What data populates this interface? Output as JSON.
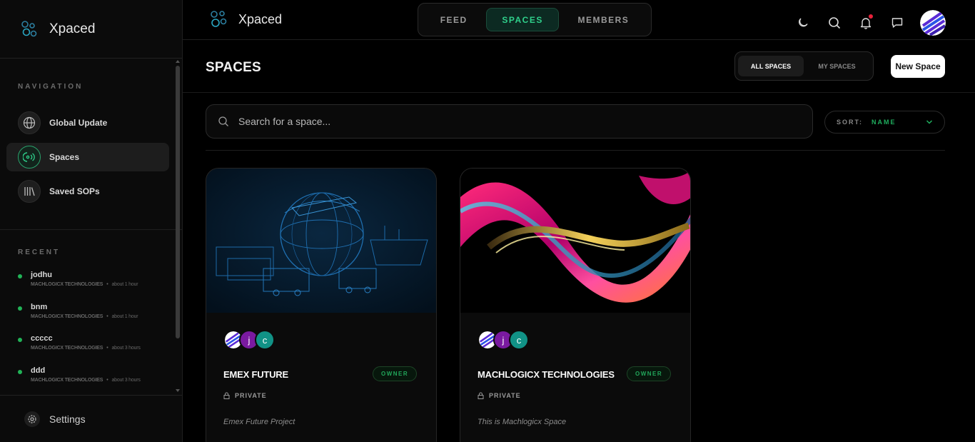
{
  "app": {
    "name": "Xpaced"
  },
  "sidebar": {
    "navigation_label": "NAVIGATION",
    "items": [
      {
        "label": "Global Update",
        "icon": "globe-icon",
        "active": false
      },
      {
        "label": "Spaces",
        "icon": "spaces-icon",
        "active": true
      },
      {
        "label": "Saved SOPs",
        "icon": "library-icon",
        "active": false
      }
    ],
    "recent_label": "RECENT",
    "recent": [
      {
        "name": "jodhu",
        "org": "MACHLOGICX TECHNOLOGIES",
        "time": "about 1 hour"
      },
      {
        "name": "bnm",
        "org": "MACHLOGICX TECHNOLOGIES",
        "time": "about 1 hour"
      },
      {
        "name": "ccccc",
        "org": "MACHLOGICX TECHNOLOGIES",
        "time": "about 3 hours"
      },
      {
        "name": "ddd",
        "org": "MACHLOGICX TECHNOLOGIES",
        "time": "about 3 hours"
      }
    ],
    "settings_label": "Settings"
  },
  "topbar": {
    "tabs": [
      {
        "label": "FEED",
        "active": false
      },
      {
        "label": "SPACES",
        "active": true
      },
      {
        "label": "MEMBERS",
        "active": false
      }
    ],
    "icons": [
      "moon-icon",
      "search-icon",
      "bell-icon",
      "chat-icon"
    ]
  },
  "page": {
    "title": "SPACES",
    "filter": {
      "all": "ALL SPACES",
      "mine": "MY SPACES",
      "selected": "all"
    },
    "new_space_label": "New Space",
    "search_placeholder": "Search for a space...",
    "sort_label": "SORT:",
    "sort_value": "NAME"
  },
  "spaces": [
    {
      "title": "EMEX FUTURE",
      "role": "OWNER",
      "privacy": "PRIVATE",
      "description": "Emex Future Project",
      "members": [
        "j",
        "c"
      ]
    },
    {
      "title": "MACHLOGICX TECHNOLOGIES",
      "role": "OWNER",
      "privacy": "PRIVATE",
      "description": "This is Machlogicx Space",
      "members": [
        "j",
        "c"
      ]
    }
  ],
  "colors": {
    "accent": "#2fd08b",
    "online": "#21b357",
    "notification": "#e8213a",
    "avatar_j": "#7a1aa0",
    "avatar_c": "#119286"
  }
}
